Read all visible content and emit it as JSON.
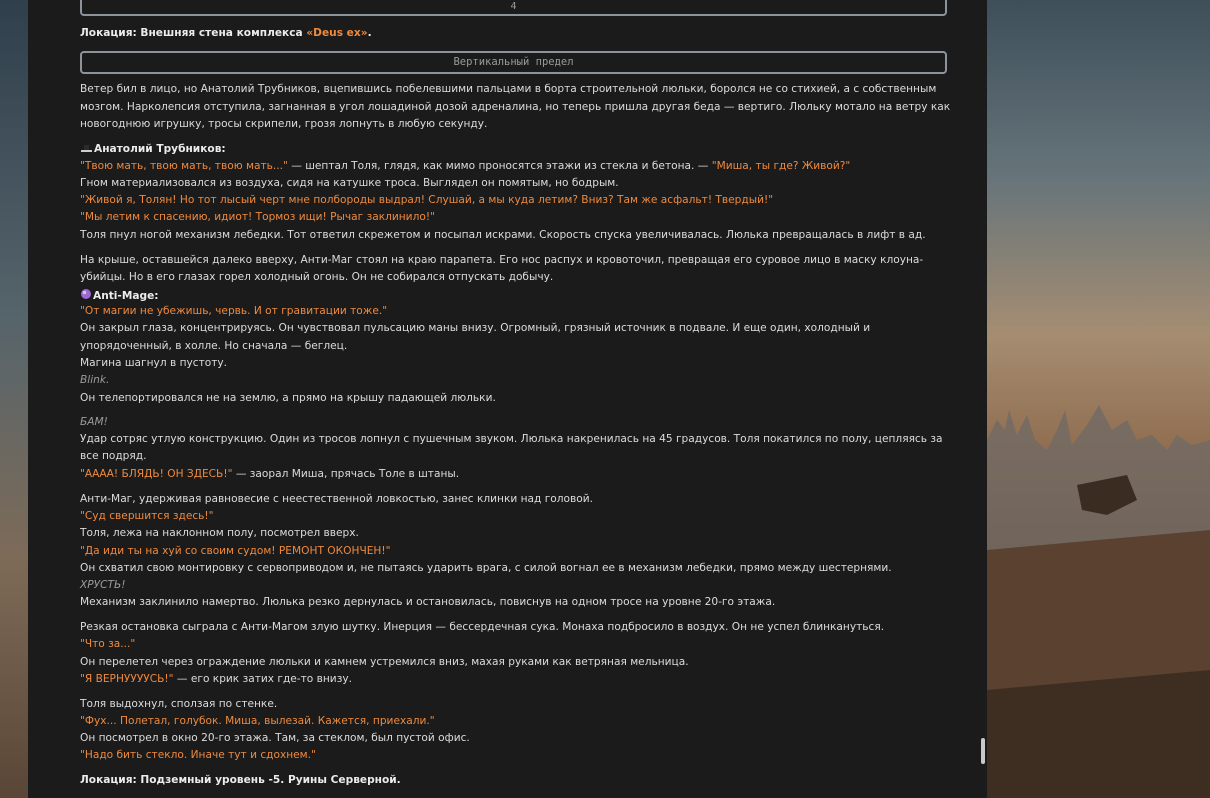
{
  "header": {
    "page_number": "4",
    "location_line": {
      "prefix": "Локация: Внешняя стена комплекса ",
      "highlight": "«Deus ex»",
      "suffix": "."
    },
    "chapter_title": "Вертикальный предел"
  },
  "story": {
    "p1": [
      "Ветер бил в лицо, но Анатолий Трубников, вцепившись побелевшими пальцами в борта строительной люльки, боролся не со стихией, а с собственным",
      "мозгом. Нарколепсия отступила, загнанная в угол лошадиной дозой адреналина, но теперь пришла другая беда — вертиго. Люльку мотало на ветру как",
      "новогоднюю игрушку, тросы скрипели, грозя лопнуть в любую секунду."
    ],
    "speaker1": "Анатолий Трубников:",
    "q1": "\"Твою мать, твою мать, твою мать...\"",
    "q1_mid": " — шептал Толя, глядя, как мимо проносятся этажи из стекла и бетона. — ",
    "q1_tail": "\"Миша, ты где? Живой?\"",
    "gnome": "Гном материализовался из воздуха, сидя на катушке троса. Выглядел он помятым, но бодрым.",
    "q2": "\"Живой я, Толян! Но тот лысый черт мне полбороды выдрал! Слушай, а мы куда летим? Вниз? Там же асфальт! Твердый!\"",
    "q3": "\"Мы летим к спасению, идиот! Тормоз ищи! Рычаг заклинило!\"",
    "kick": "Толя пнул ногой механизм лебедки. Тот ответил скрежетом и посыпал искрами. Скорость спуска увеличивалась. Люлька превращалась в лифт в ад.",
    "roof1": "На крыше, оставшейся далеко вверху, Анти-Маг стоял на краю парапета. Его нос распух и кровоточил, превращая его суровое лицо в маску клоуна-",
    "roof2": "убийцы. Но в его глазах горел холодный огонь. Он не собирался отпускать добычу.",
    "speaker2": "Anti-Mage:",
    "q4": "\"От магии не убежишь, червь. И от гравитации тоже.\"",
    "mana1": "Он закрыл глаза, концентрируясь. Он чувствовал пульсацию маны внизу. Огромный, грязный источник в подвале. И еще один, холодный и",
    "mana2": "упорядоченный, в холле. Но сначала — беглец.",
    "step": "Магина шагнул в пустоту.",
    "blink": "Blink.",
    "teleport": "Он телепортировался не на землю, а прямо на крышу падающей люльки.",
    "bam": "БАМ!",
    "hit1": "Удар сотряс утлую конструкцию. Один из тросов лопнул с пушечным звуком. Люлька накренилась на 45 градусов. Толя покатился по полу, цепляясь за",
    "hit2": "все подряд.",
    "q5": "\"АААА! БЛЯДЬ! ОН ЗДЕСЬ!\"",
    "q5_tail": " — заорал Миша, прячась Толе в штаны.",
    "am_balance": "Анти-Маг, удерживая равновесие с неестественной ловкостью, занес клинки над головой.",
    "q6": "\"Суд свершится здесь!\"",
    "tolya_up": "Толя, лежа на наклонном полу, посмотрел вверх.",
    "q7": "\"Да иди ты на хуй со своим судом! РЕМОНТ ОКОНЧЕН!\"",
    "wrench": "Он схватил свою монтировку с сервоприводом и, не пытаясь ударить врага, с силой вогнал ее в механизм лебедки, прямо между шестернями.",
    "crunch": "ХРУСТЬ!",
    "jammed": "Механизм заклинило намертво. Люлька резко дернулась и остановилась, повиснув на одном тросе на уровне 20-го этажа.",
    "stop": "Резкая остановка сыграла с Анти-Магом злую шутку. Инерция — бессердечная сука. Монаха подбросило в воздух. Он не успел блинкануться.",
    "q8": "\"Что за...\"",
    "fly": "Он перелетел через ограждение люльки и камнем устремился вниз, махая руками как ветряная мельница.",
    "q9": "\"Я ВЕРНУУУУСЬ!\"",
    "q9_tail": " — его крик затих где-то внизу.",
    "exhale": "Толя выдохнул, сползая по стенке.",
    "q10": "\"Фух... Полетал, голубок. Миша, вылезай. Кажется, приехали.\"",
    "office": "Он посмотрел в окно 20-го этажа. Там, за стеклом, был пустой офис.",
    "q11": "\"Надо бить стекло. Иначе тут и сдохнем.\"",
    "location2": "Локация: Подземный уровень -5. Руины Серверной."
  },
  "colors": {
    "dialogue": "#ef8a3e",
    "panel": "#1b1b1b",
    "text": "#dcdcdc"
  },
  "icons": {
    "speaker1_icon": "hat-icon",
    "speaker2_icon": "purple-orb-icon"
  }
}
